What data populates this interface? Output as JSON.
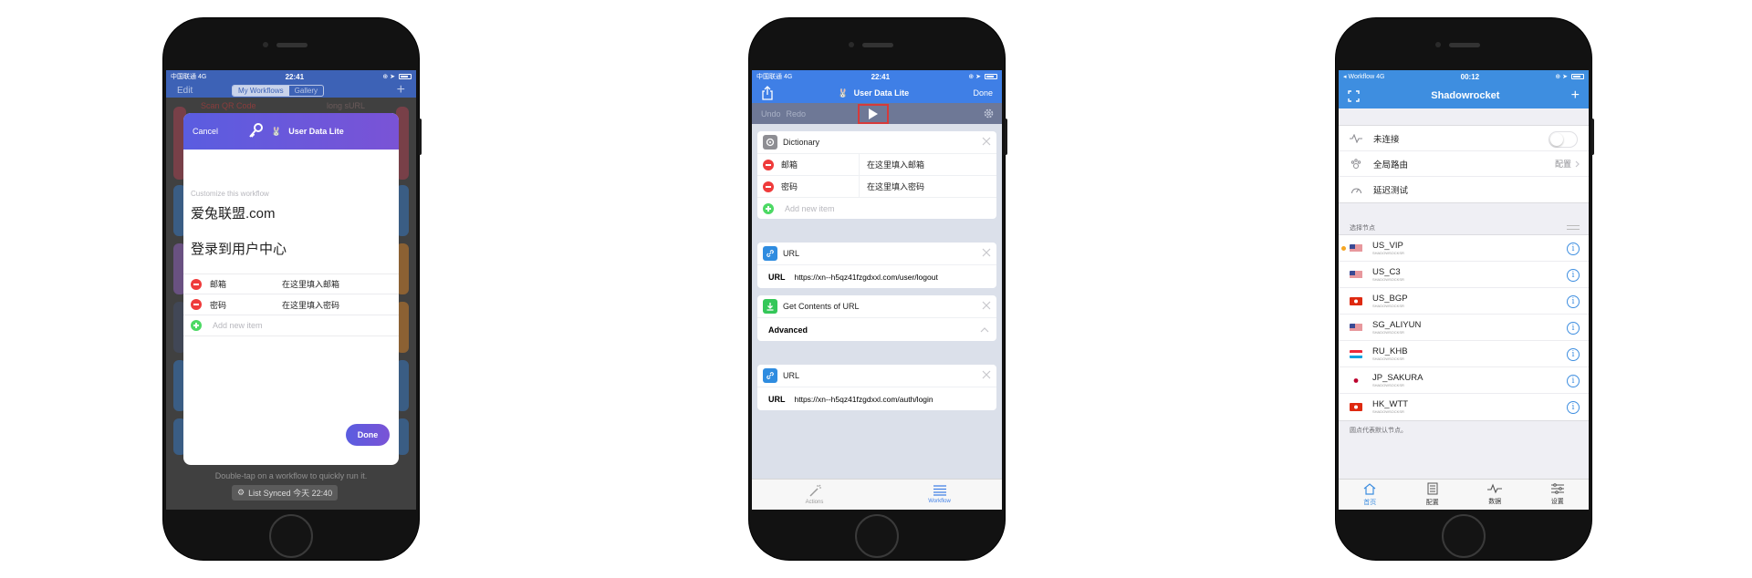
{
  "phone1": {
    "status": {
      "carrier": "中国联通",
      "network": "4G",
      "time": "22:41"
    },
    "nav": {
      "edit": "Edit",
      "tab_my": "My Workflows",
      "tab_gallery": "Gallery",
      "add": "+"
    },
    "bg_peeks": {
      "left_text": "Scan QR Code",
      "right_text": "long sURL"
    },
    "modal": {
      "cancel": "Cancel",
      "title": "User Data Lite",
      "customize_label": "Customize this workflow",
      "line1": "爱兔联盟.com",
      "line2": "登录到用户中心",
      "rows": [
        {
          "key": "邮箱",
          "value": "在这里填入邮箱"
        },
        {
          "key": "密码",
          "value": "在这里填入密码"
        }
      ],
      "add_placeholder": "Add new item",
      "done": "Done"
    },
    "hint": "Double-tap on a workflow to quickly run it.",
    "synced": "List Synced 今天 22:40"
  },
  "phone2": {
    "status": {
      "carrier": "中国联通",
      "network": "4G",
      "time": "22:41"
    },
    "nav": {
      "title": "User Data Lite",
      "done": "Done"
    },
    "toolbar": {
      "undo": "Undo",
      "redo": "Redo"
    },
    "dictionary": {
      "title": "Dictionary",
      "rows": [
        {
          "key": "邮箱",
          "value": "在这里填入邮箱"
        },
        {
          "key": "密码",
          "value": "在这里填入密码"
        }
      ],
      "add_placeholder": "Add new item"
    },
    "url1": {
      "title": "URL",
      "label": "URL",
      "value": "https://xn--h5qz41fzgdxxl.com/user/logout"
    },
    "get_contents": {
      "title": "Get Contents of URL",
      "advanced": "Advanced"
    },
    "url2": {
      "title": "URL",
      "label": "URL",
      "value": "https://xn--h5qz41fzgdxxl.com/auth/login"
    },
    "tabs": {
      "actions": "Actions",
      "workflow": "Workflow"
    }
  },
  "phone3": {
    "status": {
      "carrier": "Workflow",
      "network": "4G",
      "time": "00:12"
    },
    "nav": {
      "title": "Shadowrocket",
      "add": "+"
    },
    "settings": {
      "connect": "未连接",
      "route": "全局路由",
      "route_value": "配置",
      "latency": "延迟测试"
    },
    "section_label": "选择节点",
    "nodes": [
      {
        "name": "US_VIP",
        "sub": "SHADOWSOCKSR",
        "flag": "us",
        "selected": true
      },
      {
        "name": "US_C3",
        "sub": "SHADOWSOCKSR",
        "flag": "us",
        "selected": false
      },
      {
        "name": "US_BGP",
        "sub": "SHADOWSOCKSR",
        "flag": "hk",
        "selected": false
      },
      {
        "name": "SG_ALIYUN",
        "sub": "SHADOWSOCKSR",
        "flag": "us",
        "selected": false
      },
      {
        "name": "RU_KHB",
        "sub": "SHADOWSOCKSR",
        "flag": "lu",
        "selected": false
      },
      {
        "name": "JP_SAKURA",
        "sub": "SHADOWSOCKSR",
        "flag": "jp",
        "selected": false
      },
      {
        "name": "HK_WTT",
        "sub": "SHADOWSOCKSR",
        "flag": "hk",
        "selected": false
      }
    ],
    "footer_note": "圆点代表默认节点。",
    "tabs": {
      "home": "首页",
      "config": "配置",
      "data": "数据",
      "settings": "设置"
    }
  },
  "colors": {
    "workflow_purple": "#5a5de0",
    "workflow_blue": "#3f7fe6",
    "shadowrocket_blue": "#3e8ee0",
    "minus_red": "#ef3b3b",
    "plus_green": "#4cd964",
    "highlight_red": "#d63a3a"
  }
}
